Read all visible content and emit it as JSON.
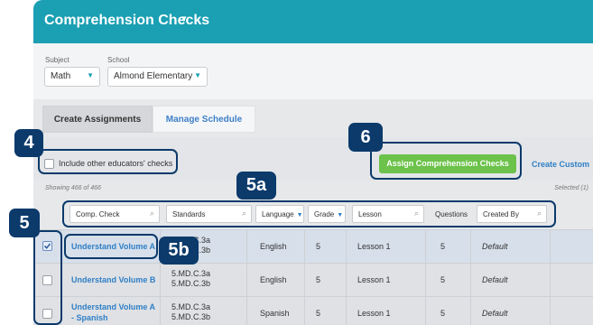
{
  "header": {
    "title": "Comprehension Checks",
    "caret": "▾"
  },
  "filters": {
    "subject_label": "Subject",
    "subject_value": "Math",
    "school_label": "School",
    "school_value": "Almond Elementary"
  },
  "tabs": [
    {
      "label": "Create Assignments",
      "active": true
    },
    {
      "label": "Manage Schedule",
      "active": false
    }
  ],
  "actions": {
    "include_label": "Include other educators' checks",
    "include_checked": false,
    "assign_label": "Assign Comprehension Checks",
    "create_custom_label": "Create Custom"
  },
  "counts": {
    "showing": "Showing 466 of 466",
    "selected": "Selected (1)"
  },
  "columns": {
    "comp_check": "Comp. Check",
    "standards": "Standards",
    "language": "Language",
    "grade": "Grade",
    "lesson": "Lesson",
    "questions": "Questions",
    "created_by": "Created By"
  },
  "rows": [
    {
      "name": "Understand Volume A",
      "std1": "5.MD.C.3a",
      "std2": "5.MD.C.3b",
      "language": "English",
      "grade": "5",
      "lesson": "Lesson 1",
      "questions": "5",
      "created_by": "Default",
      "checked": true
    },
    {
      "name": "Understand Volume B",
      "std1": "5.MD.C.3a",
      "std2": "5.MD.C.3b",
      "language": "English",
      "grade": "5",
      "lesson": "Lesson 1",
      "questions": "5",
      "created_by": "Default",
      "checked": false
    },
    {
      "name": "Understand Volume A",
      "name2": "- Spanish",
      "std1": "5.MD.C.3a",
      "std2": "5.MD.C.3b",
      "language": "Spanish",
      "grade": "5",
      "lesson": "Lesson 1",
      "questions": "5",
      "created_by": "Default",
      "checked": false
    }
  ],
  "callouts": {
    "c4": "4",
    "c5": "5",
    "c5a": "5a",
    "c5b": "5b",
    "c6": "6"
  },
  "colors": {
    "header": "#1a9fb3",
    "callout": "#0b3a6b",
    "assign_button": "#6cc24a",
    "link": "#2f7fc6"
  },
  "icons": {
    "search": "search-icon",
    "check": "check-icon",
    "caret": "chevron-down-icon"
  }
}
